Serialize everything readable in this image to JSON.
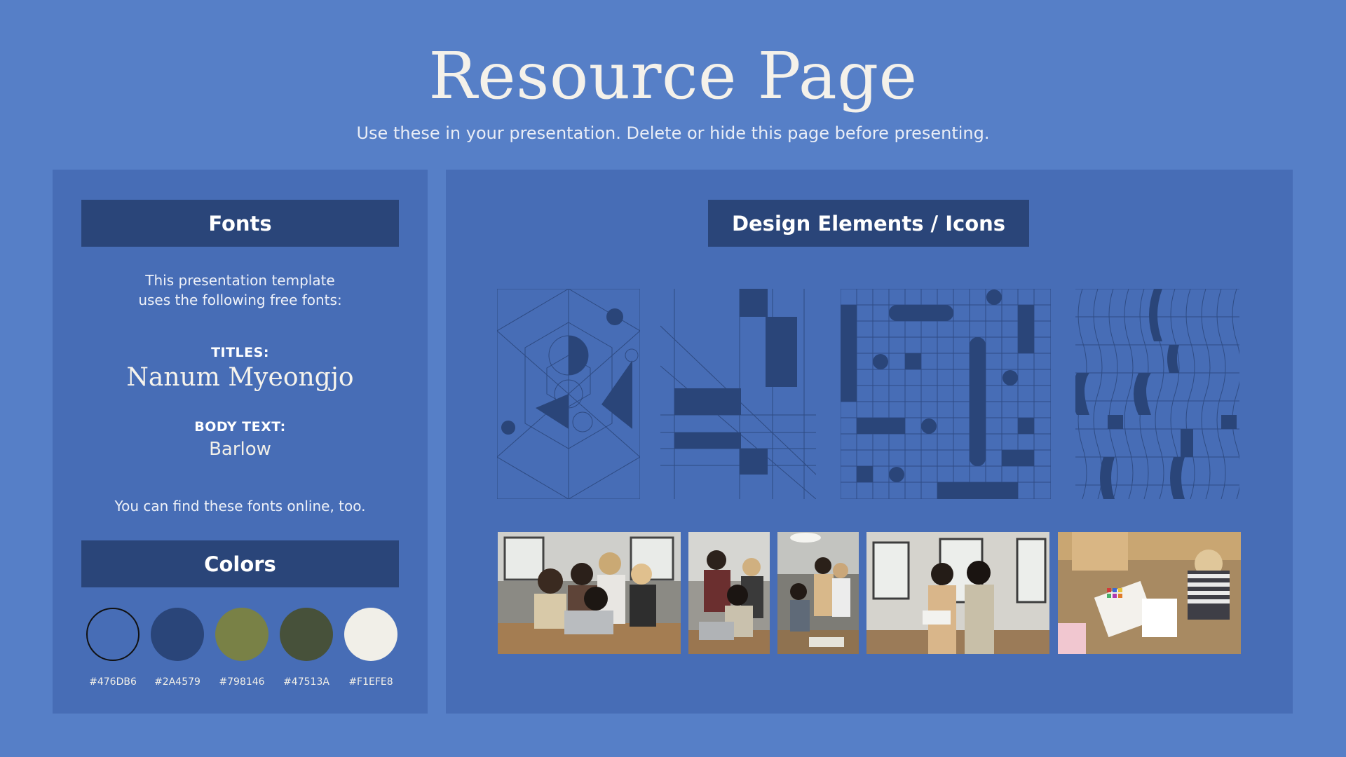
{
  "page": {
    "title": "Resource Page",
    "subtitle": "Use these in your presentation. Delete or hide this page before presenting."
  },
  "fonts": {
    "header": "Fonts",
    "intro_line1": "This presentation template",
    "intro_line2": "uses the following free fonts:",
    "titles_label": "TITLES:",
    "titles_font": "Nanum Myeongjo",
    "body_label": "BODY TEXT:",
    "body_font": "Barlow",
    "online_note": "You can find these fonts online, too."
  },
  "colors": {
    "header": "Colors",
    "swatches": [
      {
        "hex": "#476DB6",
        "fill": "#476db6"
      },
      {
        "hex": "#2A4579",
        "fill": "#2a4579"
      },
      {
        "hex": "#798146",
        "fill": "#798146"
      },
      {
        "hex": "#47513A",
        "fill": "#47513a"
      },
      {
        "hex": "#F1EFE8",
        "fill": "#f1efe8"
      }
    ]
  },
  "design": {
    "header": "Design Elements / Icons",
    "patterns": [
      "hexagon-geometric-pattern",
      "grid-block-pattern",
      "grid-dots-pattern",
      "wave-lines-pattern"
    ],
    "photos": [
      "team-laptop-photo",
      "team-group-photo",
      "office-meeting-photo",
      "two-colleagues-photo",
      "design-swatches-photo"
    ]
  }
}
